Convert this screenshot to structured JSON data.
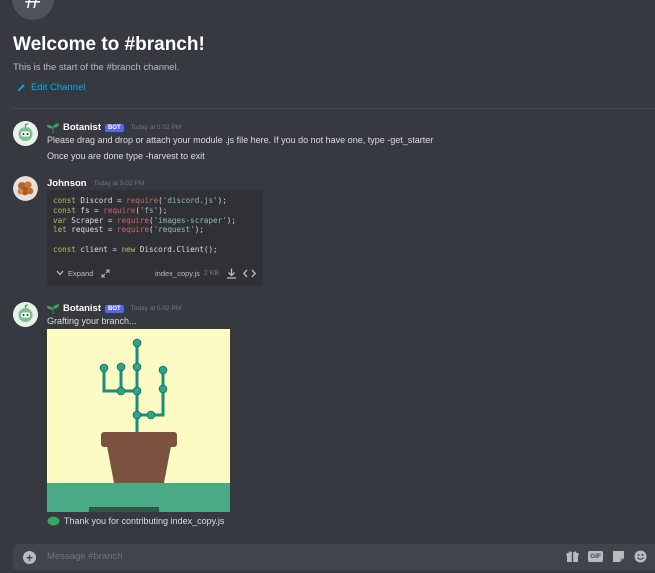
{
  "channel": {
    "welcome_title": "Welcome to #branch!",
    "start_text": "This is the start of the #branch channel.",
    "edit_label": "Edit Channel"
  },
  "messages": [
    {
      "author": "Botanist",
      "bot_tag": "BOT",
      "timestamp": "Today at 5:02 PM",
      "lines": [
        "Please drag and drop or attach your module .js file here. If you do not have one, type -get_starter",
        "Once you are done type -harvest to exit"
      ]
    },
    {
      "author": "Johnson",
      "timestamp": "Today at 5:02 PM",
      "attachment": {
        "expand_label": "Expand",
        "filename": "index_copy.js",
        "size": "2 KB"
      }
    },
    {
      "author": "Botanist",
      "bot_tag": "BOT",
      "timestamp": "Today at 5:02 PM",
      "lines": [
        "Grafting your branch..."
      ],
      "reaction_text": "Thank you for contributing index_copy.js"
    }
  ],
  "composer": {
    "placeholder": "Message #branch",
    "gif_label": "GIF"
  },
  "colors": {
    "background": "#36393f",
    "link": "#00aff4",
    "bot_badge": "#5865f2",
    "image_bg": "#fdfbc4",
    "pot": "#7b5240",
    "stem": "#1b8e7a",
    "ground": "#4aaa86"
  }
}
